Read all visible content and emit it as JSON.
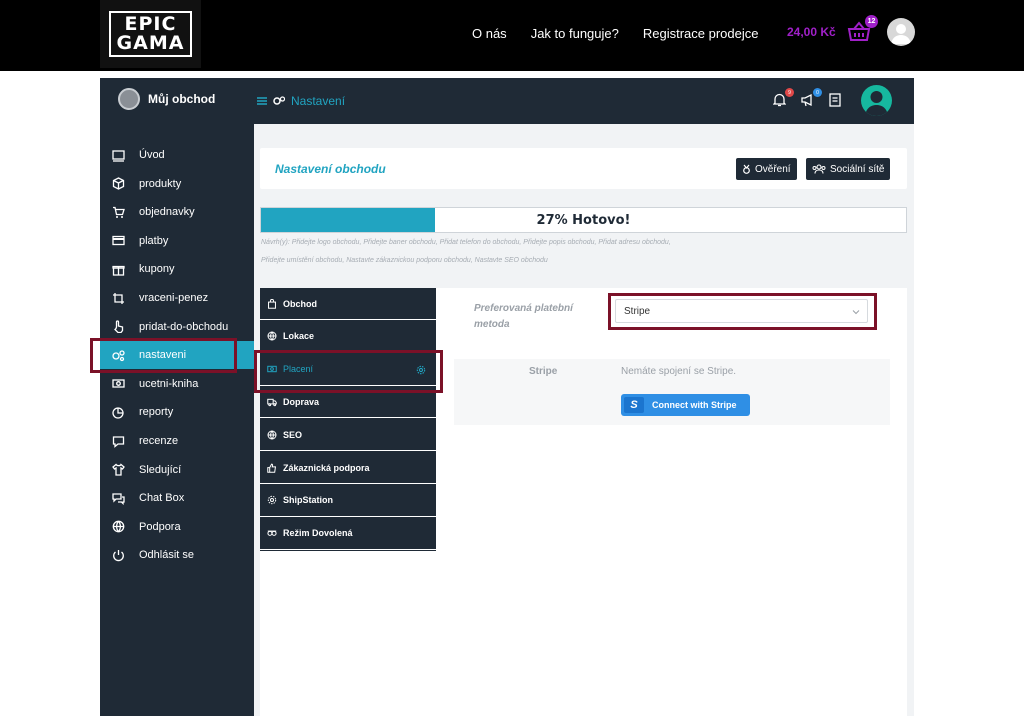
{
  "site": {
    "logo_line1": "EPIC",
    "logo_line2": "GAMA",
    "nav": [
      "O nás",
      "Jak to funguje?",
      "Registrace prodejce"
    ],
    "cart_total": "24,00 Kč",
    "cart_count": "12"
  },
  "header": {
    "shop_name": "Můj obchod",
    "crumb": "Nastavení",
    "notif_count": "9",
    "announce_count": "0",
    "colors": {
      "dark": "#1f2a36",
      "accent": "#21a4c1",
      "red_badge": "#e04848",
      "blue_badge": "#2f8fe5"
    }
  },
  "sidebar": {
    "items": [
      {
        "label": "Úvod",
        "icon": "monitor-icon"
      },
      {
        "label": "produkty",
        "icon": "box-icon"
      },
      {
        "label": "objednavky",
        "icon": "cart-icon"
      },
      {
        "label": "platby",
        "icon": "credit-card-icon"
      },
      {
        "label": "kupony",
        "icon": "gift-icon"
      },
      {
        "label": "vraceni-penez",
        "icon": "crop-icon"
      },
      {
        "label": "pridat-do-obchodu",
        "icon": "hand-pointer-icon"
      },
      {
        "label": "nastaveni",
        "icon": "gears-icon",
        "active": true
      },
      {
        "label": "ucetni-kniha",
        "icon": "money-icon"
      },
      {
        "label": "reporty",
        "icon": "chart-pie-icon"
      },
      {
        "label": "recenze",
        "icon": "comment-icon"
      },
      {
        "label": "Sledující",
        "icon": "shirt-icon"
      },
      {
        "label": "Chat Box",
        "icon": "comments-icon"
      },
      {
        "label": "Podpora",
        "icon": "globe-icon"
      },
      {
        "label": "Odhlásit se",
        "icon": "power-icon"
      }
    ]
  },
  "settings": {
    "title": "Nastavení obchodu",
    "verify_btn": "Ověření",
    "social_btn": "Sociální sítě",
    "progress_percent": 27,
    "progress_label": "27% Hotovo!",
    "hint_line1": "Návrh(y): Přidejte logo obchodu, Přidejte baner obchodu, Přidat telefon do obchodu, Přidejte popis obchodu, Přidat adresu obchodu,",
    "hint_line2": "Přidejte umístění obchodu, Nastavte zákaznickou podporu obchodu, Nastavte SEO obchodu",
    "tabs": [
      {
        "label": "Obchod",
        "icon": "shop-bag-icon"
      },
      {
        "label": "Lokace",
        "icon": "globe-icon"
      },
      {
        "label": "Placení",
        "icon": "money-icon",
        "active": true
      },
      {
        "label": "Doprava",
        "icon": "truck-icon"
      },
      {
        "label": "SEO",
        "icon": "globe-icon"
      },
      {
        "label": "Zákaznická podpora",
        "icon": "thumbs-up-icon"
      },
      {
        "label": "ShipStation",
        "icon": "gear-icon"
      },
      {
        "label": "Režim Dovolená",
        "icon": "tripadvisor-icon"
      }
    ],
    "payment_method_label": "Preferovaná platební metoda",
    "payment_method_value": "Stripe",
    "stripe_label": "Stripe",
    "stripe_message": "Nemáte spojení se Stripe.",
    "stripe_connect": "Connect with Stripe",
    "stripe_s": "S"
  }
}
